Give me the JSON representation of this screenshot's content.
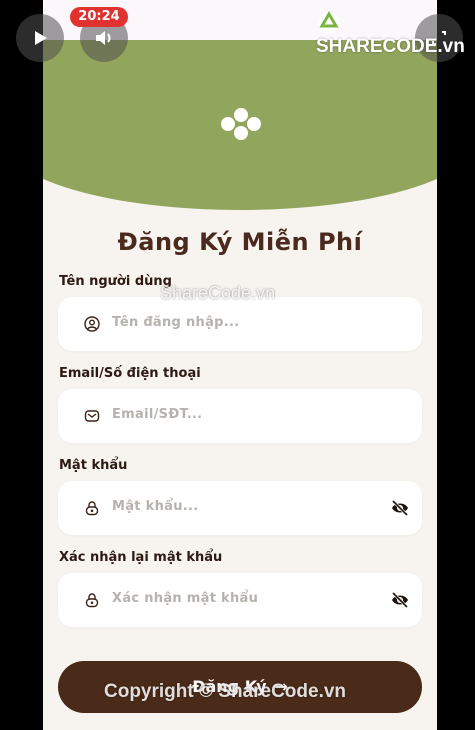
{
  "status": {
    "time": "20:24"
  },
  "header": {
    "logo_icon": "flower-icon",
    "accent": "#92a55c"
  },
  "form": {
    "title": "Đăng Ký Miễn Phí",
    "fields": [
      {
        "label": "Tên người dùng",
        "placeholder": "Tên đăng nhập...",
        "icon": "user-icon"
      },
      {
        "label": "Email/Số điện thoại",
        "placeholder": "Email/SĐT...",
        "icon": "mail-icon"
      },
      {
        "label": "Mật khẩu",
        "placeholder": "Mật khẩu...",
        "icon": "lock-icon",
        "toggle_icon": "eye-off-icon"
      },
      {
        "label": "Xác nhận lại mật khẩu",
        "placeholder": "Xác nhận mật khẩu",
        "icon": "lock-icon",
        "toggle_icon": "eye-off-icon"
      }
    ],
    "submit_label": "Đăng Ký",
    "submit_arrow": "→",
    "button_color": "#4a2a18"
  },
  "watermark": {
    "logo": "SHARECODE.vn",
    "center": "ShareCode.vn",
    "bottom": "Copyright © ShareCode.vn"
  }
}
